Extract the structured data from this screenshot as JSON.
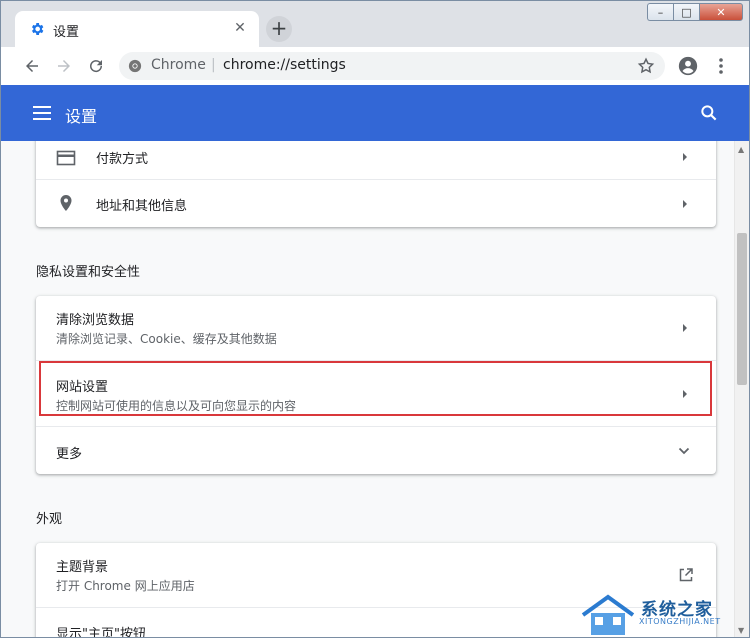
{
  "browser": {
    "tab_title": "设置",
    "new_tab_symbol": "+",
    "close_symbol": "✕",
    "site_name": "Chrome",
    "separator": "|",
    "url": "chrome://settings"
  },
  "window_controls": {
    "min": "–",
    "max": "□",
    "close": "✕"
  },
  "header": {
    "title": "设置"
  },
  "sections": {
    "autofill_items": [
      {
        "label": "付款方式",
        "icon": "credit-card-icon"
      },
      {
        "label": "地址和其他信息",
        "icon": "location-pin-icon"
      }
    ],
    "privacy": {
      "title": "隐私设置和安全性",
      "items": [
        {
          "label": "清除浏览数据",
          "sub": "清除浏览记录、Cookie、缓存及其他数据"
        },
        {
          "label": "网站设置",
          "sub": "控制网站可使用的信息以及可向您显示的内容"
        },
        {
          "label": "更多"
        }
      ]
    },
    "appearance": {
      "title": "外观",
      "items": [
        {
          "label": "主题背景",
          "sub": "打开 Chrome 网上应用店"
        },
        {
          "label": "显示\"主页\"按钮"
        }
      ]
    }
  },
  "watermark": {
    "text": "系统之家",
    "url": "XITONGZHIJIA.NET"
  },
  "colors": {
    "accent": "#3367d6",
    "highlight": "#d9383b"
  }
}
